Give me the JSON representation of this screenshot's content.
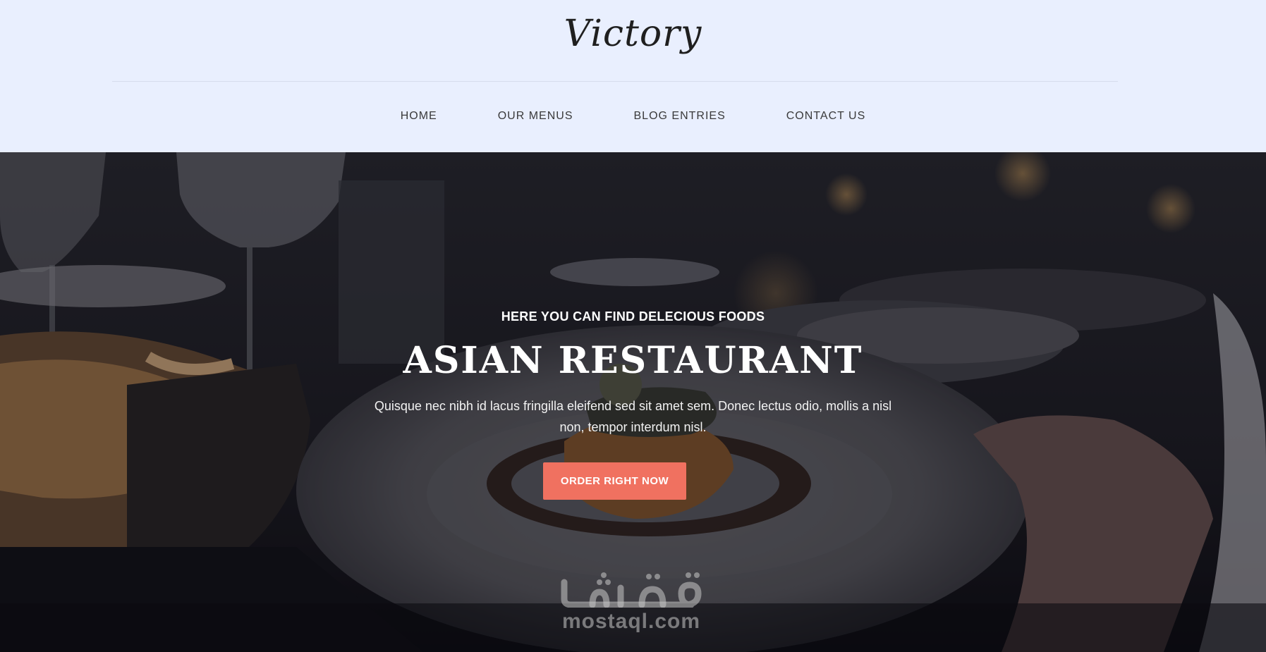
{
  "header": {
    "brand": "Victory",
    "nav": [
      {
        "label": "HOME"
      },
      {
        "label": "OUR MENUS"
      },
      {
        "label": "BLOG ENTRIES"
      },
      {
        "label": "CONTACT US"
      }
    ]
  },
  "hero": {
    "subtitle": "HERE YOU CAN FIND DELECIOUS FOODS",
    "title": "ASIAN RESTAURANT",
    "text": "Quisque nec nibh id lacus fringilla eleifend sed sit amet sem. Donec lectus odio, mollis a nisl non, tempor interdum nisl.",
    "cta_label": "ORDER RIGHT NOW",
    "background_image": "restaurant-table-dinner-photo"
  },
  "watermark": {
    "arabic": "مستقل",
    "text": "mostaql.com"
  },
  "colors": {
    "header_bg": "#e9effe",
    "cta": "#f07160",
    "hero_text": "#ffffff"
  }
}
